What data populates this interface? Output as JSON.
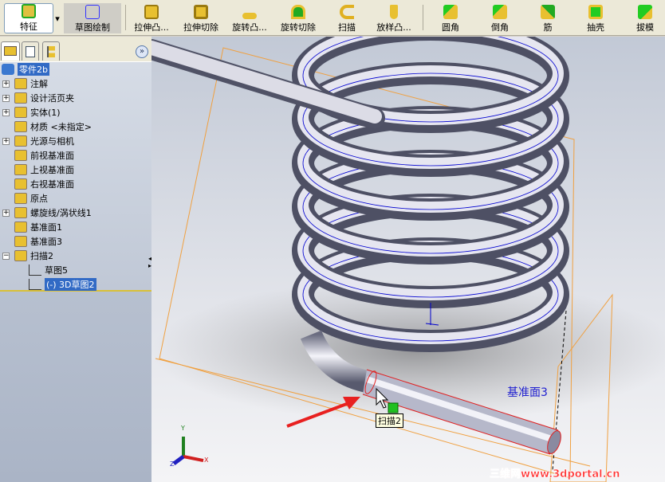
{
  "toolbar": {
    "items": [
      {
        "label": "特征",
        "icon": "feature-icon"
      },
      {
        "label": "草图绘制",
        "icon": "sketch-icon"
      },
      {
        "label": "拉伸凸...",
        "icon": "extrude-boss-icon"
      },
      {
        "label": "拉伸切除",
        "icon": "extrude-cut-icon"
      },
      {
        "label": "旋转凸...",
        "icon": "revolve-boss-icon"
      },
      {
        "label": "旋转切除",
        "icon": "revolve-cut-icon"
      },
      {
        "label": "扫描",
        "icon": "sweep-icon"
      },
      {
        "label": "放样凸...",
        "icon": "loft-icon"
      },
      {
        "label": "圆角",
        "icon": "fillet-icon"
      },
      {
        "label": "倒角",
        "icon": "chamfer-icon"
      },
      {
        "label": "筋",
        "icon": "rib-icon"
      },
      {
        "label": "抽壳",
        "icon": "shell-icon"
      },
      {
        "label": "拔模",
        "icon": "draft-icon"
      }
    ]
  },
  "tree": {
    "root": "零件2b",
    "items": [
      {
        "label": "注解",
        "expand": "+",
        "icon": "annotation-icon"
      },
      {
        "label": "设计活页夹",
        "expand": "+",
        "icon": "design-binder-icon"
      },
      {
        "label": "实体(1)",
        "expand": "+",
        "icon": "solid-bodies-icon"
      },
      {
        "label": "材质 <未指定>",
        "expand": "",
        "icon": "material-icon"
      },
      {
        "label": "光源与相机",
        "expand": "+",
        "icon": "lights-icon"
      },
      {
        "label": "前视基准面",
        "expand": "",
        "icon": "plane-icon"
      },
      {
        "label": "上视基准面",
        "expand": "",
        "icon": "plane-icon"
      },
      {
        "label": "右视基准面",
        "expand": "",
        "icon": "plane-icon"
      },
      {
        "label": "原点",
        "expand": "",
        "icon": "origin-icon"
      },
      {
        "label": "螺旋线/涡状线1",
        "expand": "+",
        "icon": "helix-icon"
      },
      {
        "label": "基准面1",
        "expand": "",
        "icon": "ref-plane-icon"
      },
      {
        "label": "基准面3",
        "expand": "",
        "icon": "ref-plane-icon"
      },
      {
        "label": "扫描2",
        "expand": "−",
        "icon": "sweep-icon"
      }
    ],
    "children": [
      {
        "label": "草图5",
        "icon": "sketch-icon"
      },
      {
        "label": "(-) 3D草图2",
        "icon": "3d-sketch-icon",
        "selected": true
      }
    ]
  },
  "viewport": {
    "plane_label": "基准面3",
    "tooltip": "扫描2",
    "watermark": "三维网www.3dportal.cn",
    "axes": {
      "x": "X",
      "y": "Y",
      "z": "Z"
    }
  },
  "colors": {
    "accent": "#316ac5",
    "plane": "#f0a040",
    "selection": "#e02020",
    "sketch": "#0000d0"
  }
}
